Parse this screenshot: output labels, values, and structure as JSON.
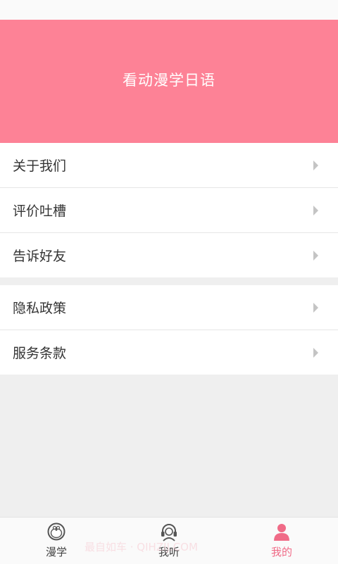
{
  "banner": {
    "title": "看动漫学日语"
  },
  "menu": {
    "group1": [
      {
        "label": "关于我们"
      },
      {
        "label": "评价吐槽"
      },
      {
        "label": "告诉好友"
      }
    ],
    "group2": [
      {
        "label": "隐私政策"
      },
      {
        "label": "服务条款"
      }
    ]
  },
  "tabbar": {
    "tabs": [
      {
        "label": "漫学",
        "icon": "doraemon-icon"
      },
      {
        "label": "我听",
        "icon": "headset-icon"
      },
      {
        "label": "我的",
        "icon": "person-icon",
        "active": true
      }
    ]
  },
  "watermark": {
    "text": "最自如车 · QIHZIJ.COM"
  },
  "colors": {
    "accent": "#fd8296",
    "active_tab": "#f06b87"
  }
}
